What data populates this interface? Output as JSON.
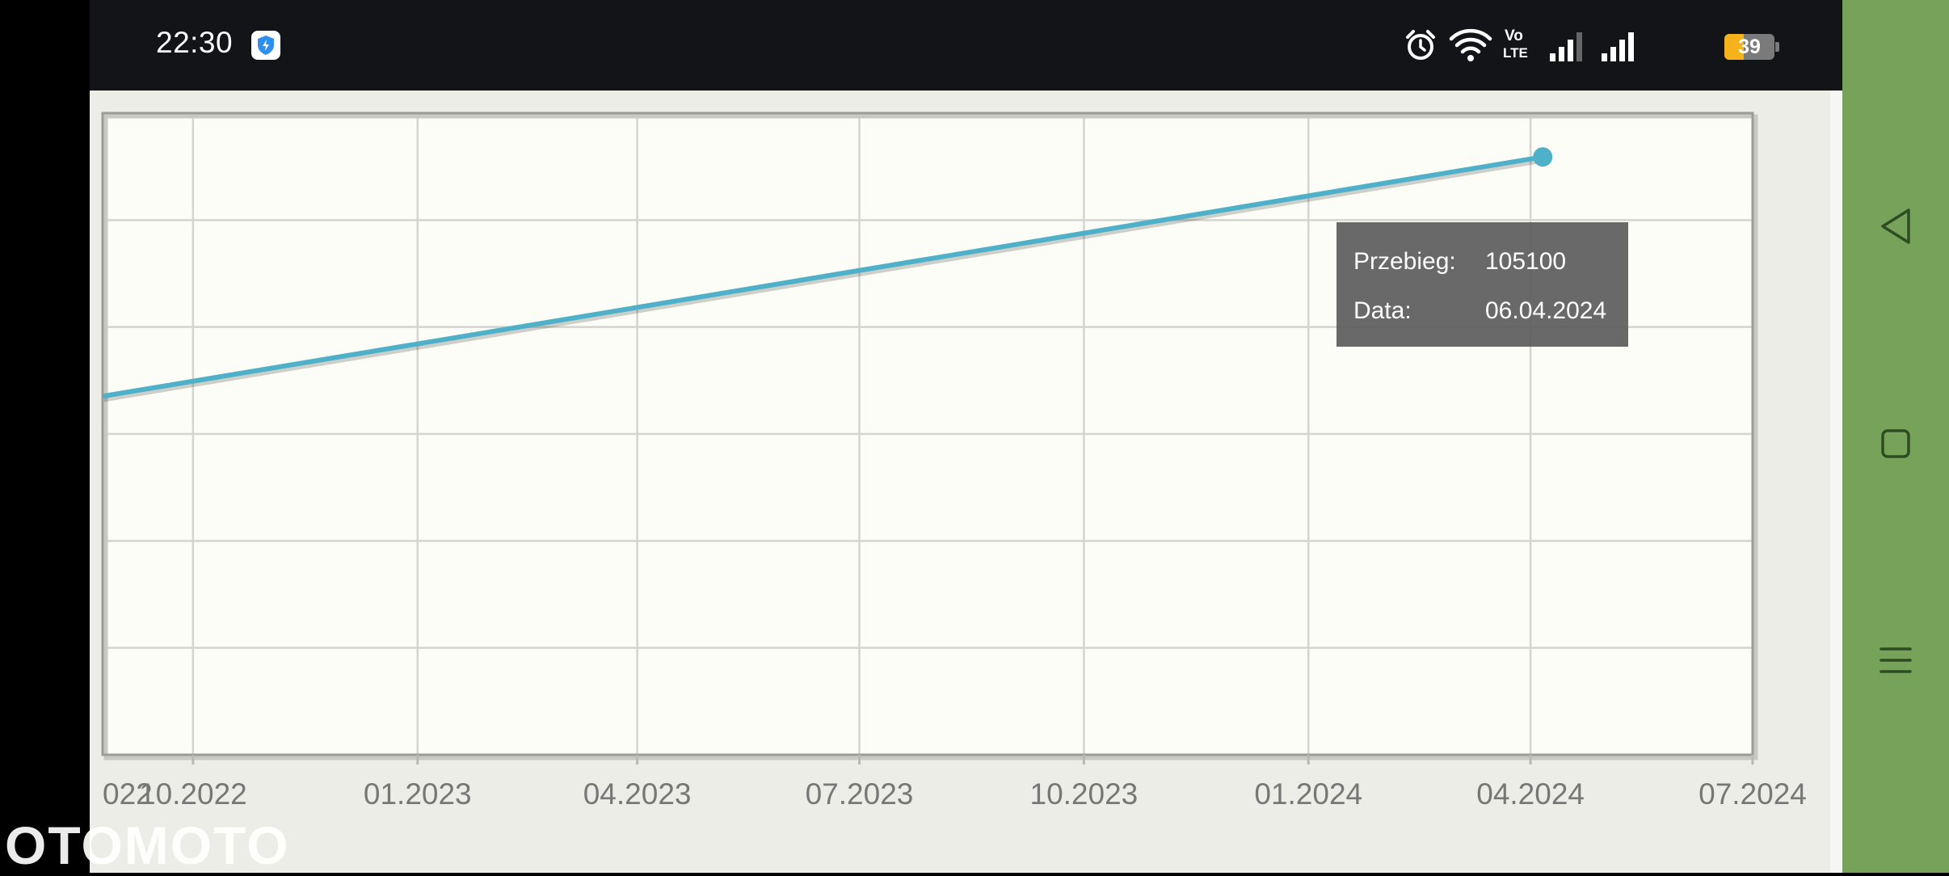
{
  "status_bar": {
    "time": "22:30",
    "app_icon": "shield-icon",
    "vo_lte_label_top": "Vo",
    "vo_lte_label_bottom": "LTE",
    "battery_level": "39",
    "battery_fraction": 0.39,
    "colors": {
      "battery_fill": "#f6b21b",
      "background": "#131417"
    }
  },
  "watermark": {
    "text": "OTOMOTO"
  },
  "chart_data": {
    "type": "line",
    "x_tick_labels": [
      "022",
      "10.2022",
      "01.2023",
      "04.2023",
      "07.2023",
      "10.2023",
      "01.2024",
      "04.2024",
      "07.2024"
    ],
    "x_ticks": [
      "2022-07-01",
      "2022-10-01",
      "2023-01-01",
      "2023-04-01",
      "2023-07-01",
      "2023-10-01",
      "2024-01-01",
      "2024-04-01",
      "2024-07-01"
    ],
    "xlim": [
      "2022-07-01",
      "2024-07-01"
    ],
    "series": [
      {
        "color": "#4fb1c9",
        "points": [
          {
            "x": "2022-06-20",
            "y": 96600
          },
          {
            "x": "2024-04-06",
            "y": 105100
          }
        ]
      }
    ],
    "ylim": [
      86000,
      106500
    ],
    "grid": true,
    "tooltip": {
      "rows": [
        {
          "label": "Przebieg:",
          "value": "105100"
        },
        {
          "label": "Data:",
          "value": "06.04.2024"
        }
      ]
    }
  },
  "nav_bar": {
    "back_icon": "back-triangle-icon",
    "home_icon": "home-square-icon",
    "recents_icon": "menu-lines-icon",
    "color": "#76a25a"
  }
}
